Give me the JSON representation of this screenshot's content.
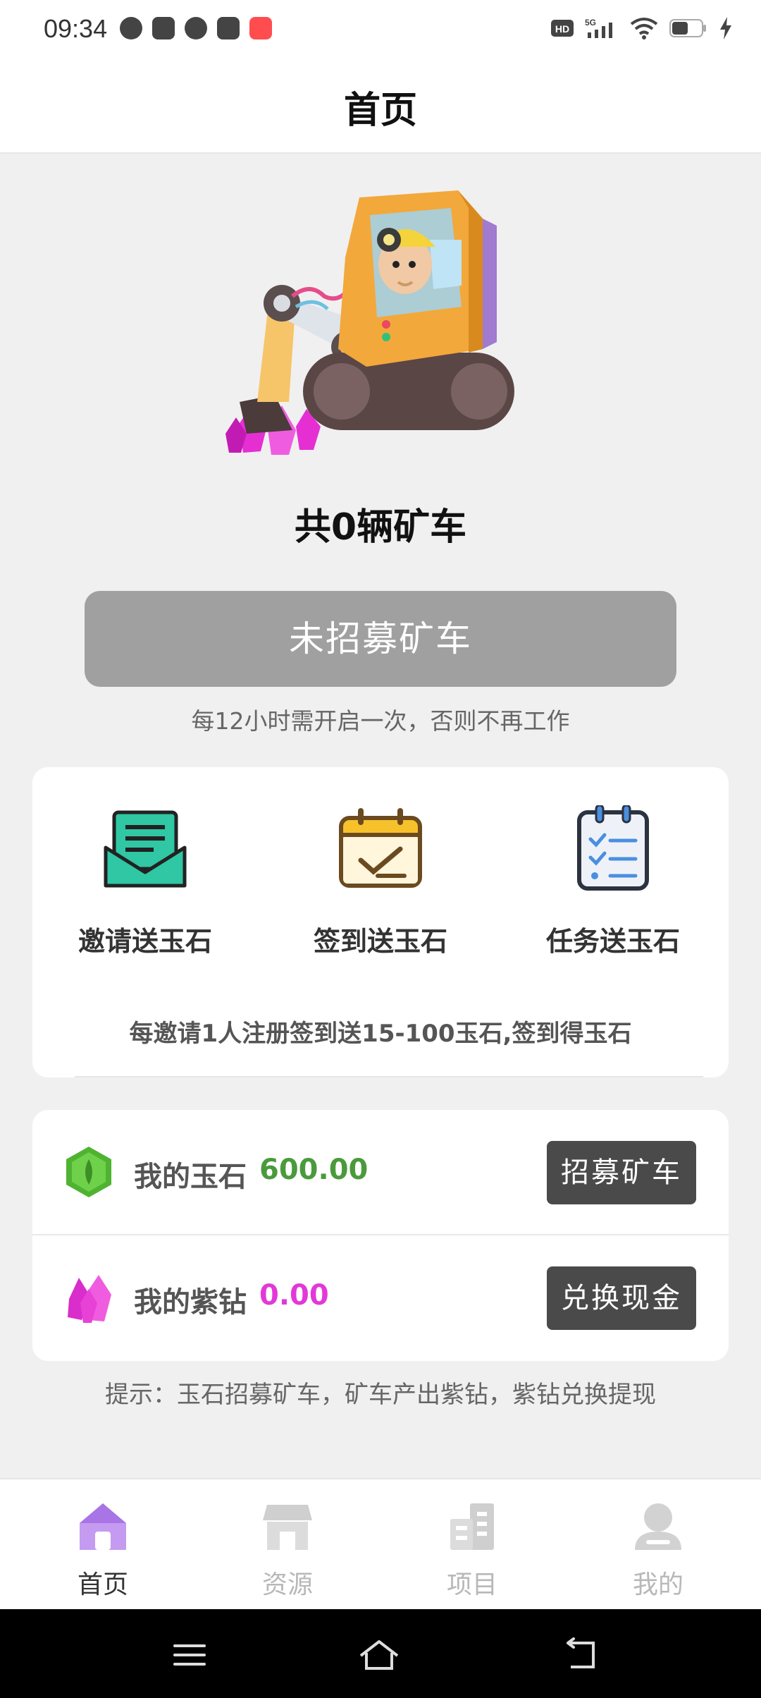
{
  "status_bar": {
    "time": "09:34",
    "icons_left": [
      "speed-icon",
      "calendar-icon",
      "chat-icon",
      "bag-icon",
      "app-icon"
    ],
    "icons_right": [
      "hd-icon",
      "5g-signal-icon",
      "wifi-icon",
      "battery-icon",
      "charging-icon"
    ]
  },
  "header": {
    "title": "首页"
  },
  "hero": {
    "cart_count_text": "共0辆矿车"
  },
  "recruit": {
    "button_label": "未招募矿车",
    "hint": "每12小时需开启一次，否则不再工作"
  },
  "actions": {
    "items": [
      {
        "label": "邀请送玉石",
        "icon": "invite-envelope-icon"
      },
      {
        "label": "签到送玉石",
        "icon": "checkin-calendar-icon"
      },
      {
        "label": "任务送玉石",
        "icon": "task-checklist-icon"
      }
    ],
    "note": "每邀请1人注册签到送15-100玉石,签到得玉石"
  },
  "balances": {
    "jade": {
      "label": "我的玉石",
      "value": "600.00",
      "button": "招募矿车",
      "color": "#4a9a3c"
    },
    "diamond": {
      "label": "我的紫钻",
      "value": "0.00",
      "button": "兑换现金",
      "color": "#e338d8"
    }
  },
  "tip": "提示：玉石招募矿车，矿车产出紫钻，紫钻兑换提现",
  "tabs": [
    {
      "label": "首页",
      "icon": "home-icon",
      "active": true
    },
    {
      "label": "资源",
      "icon": "store-icon",
      "active": false
    },
    {
      "label": "项目",
      "icon": "buildings-icon",
      "active": false
    },
    {
      "label": "我的",
      "icon": "user-icon",
      "active": false
    }
  ],
  "colors": {
    "accent": "#c49bf0",
    "button_dark": "#4a4a4a",
    "disabled": "#a0a0a0"
  }
}
